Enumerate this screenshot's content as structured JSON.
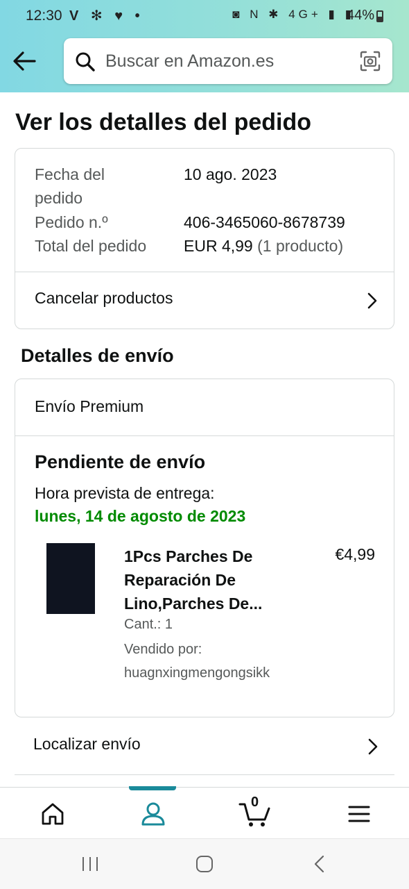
{
  "status_bar": {
    "time": "12:30",
    "left_icons": "V ✻ ♥ •",
    "right_icons": "◙ N ✱ 4G+ ▮ ▮",
    "battery": "44%"
  },
  "header": {
    "search_placeholder": "Buscar en Amazon.es"
  },
  "page": {
    "title": "Ver los detalles del pedido"
  },
  "order": {
    "date_label": "Fecha del",
    "date_label_2": "pedido",
    "date_value": "10 ago. 2023",
    "number_label": "Pedido n.º",
    "number_value": "406-3465060-8678739",
    "total_label": "Total del pedido",
    "total_value": "EUR 4,99",
    "total_count": "(1 producto)",
    "cancel_label": "Cancelar productos"
  },
  "shipping": {
    "section_title": "Detalles de envío",
    "type": "Envío Premium",
    "status": "Pendiente de envío",
    "eta_label": "Hora prevista de entrega:",
    "eta_date": "lunes, 14 de agosto de 2023",
    "product": {
      "title": "1Pcs Parches De Reparación De Lino,Parches De...",
      "price": "€4,99",
      "qty": "Cant.: 1",
      "seller_label": "Vendido por:",
      "seller": "huagnxingmengongsikk"
    },
    "track_label": "Localizar envío"
  },
  "bottom_nav": {
    "cart_count": "0"
  },
  "colors": {
    "header_gradient_start": "#82d8e3",
    "header_gradient_end": "#a6e6ce",
    "delivery_green": "#008a00",
    "nav_accent": "#1a8a9a"
  }
}
